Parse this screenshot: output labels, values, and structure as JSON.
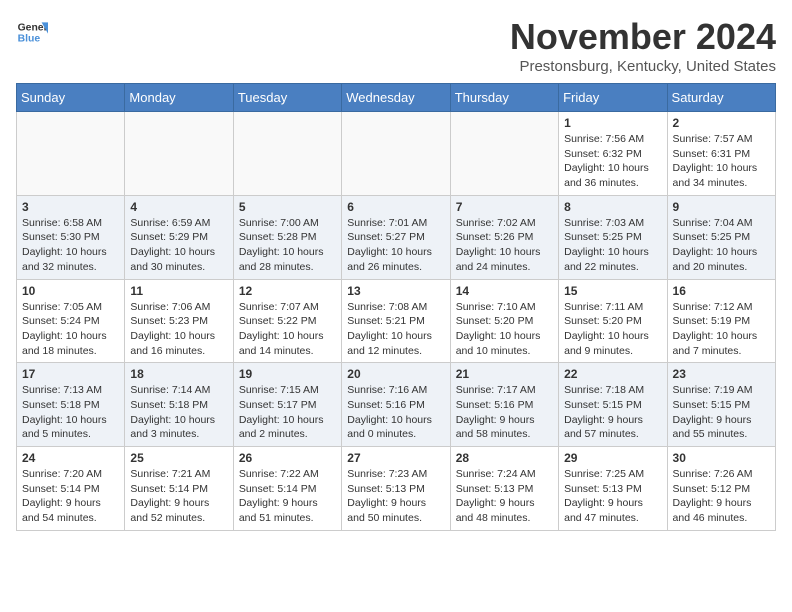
{
  "header": {
    "logo_line1": "General",
    "logo_line2": "Blue",
    "month_year": "November 2024",
    "location": "Prestonsburg, Kentucky, United States"
  },
  "days_of_week": [
    "Sunday",
    "Monday",
    "Tuesday",
    "Wednesday",
    "Thursday",
    "Friday",
    "Saturday"
  ],
  "weeks": [
    [
      {
        "day": "",
        "info": ""
      },
      {
        "day": "",
        "info": ""
      },
      {
        "day": "",
        "info": ""
      },
      {
        "day": "",
        "info": ""
      },
      {
        "day": "",
        "info": ""
      },
      {
        "day": "1",
        "info": "Sunrise: 7:56 AM\nSunset: 6:32 PM\nDaylight: 10 hours and 36 minutes."
      },
      {
        "day": "2",
        "info": "Sunrise: 7:57 AM\nSunset: 6:31 PM\nDaylight: 10 hours and 34 minutes."
      }
    ],
    [
      {
        "day": "3",
        "info": "Sunrise: 6:58 AM\nSunset: 5:30 PM\nDaylight: 10 hours and 32 minutes."
      },
      {
        "day": "4",
        "info": "Sunrise: 6:59 AM\nSunset: 5:29 PM\nDaylight: 10 hours and 30 minutes."
      },
      {
        "day": "5",
        "info": "Sunrise: 7:00 AM\nSunset: 5:28 PM\nDaylight: 10 hours and 28 minutes."
      },
      {
        "day": "6",
        "info": "Sunrise: 7:01 AM\nSunset: 5:27 PM\nDaylight: 10 hours and 26 minutes."
      },
      {
        "day": "7",
        "info": "Sunrise: 7:02 AM\nSunset: 5:26 PM\nDaylight: 10 hours and 24 minutes."
      },
      {
        "day": "8",
        "info": "Sunrise: 7:03 AM\nSunset: 5:25 PM\nDaylight: 10 hours and 22 minutes."
      },
      {
        "day": "9",
        "info": "Sunrise: 7:04 AM\nSunset: 5:25 PM\nDaylight: 10 hours and 20 minutes."
      }
    ],
    [
      {
        "day": "10",
        "info": "Sunrise: 7:05 AM\nSunset: 5:24 PM\nDaylight: 10 hours and 18 minutes."
      },
      {
        "day": "11",
        "info": "Sunrise: 7:06 AM\nSunset: 5:23 PM\nDaylight: 10 hours and 16 minutes."
      },
      {
        "day": "12",
        "info": "Sunrise: 7:07 AM\nSunset: 5:22 PM\nDaylight: 10 hours and 14 minutes."
      },
      {
        "day": "13",
        "info": "Sunrise: 7:08 AM\nSunset: 5:21 PM\nDaylight: 10 hours and 12 minutes."
      },
      {
        "day": "14",
        "info": "Sunrise: 7:10 AM\nSunset: 5:20 PM\nDaylight: 10 hours and 10 minutes."
      },
      {
        "day": "15",
        "info": "Sunrise: 7:11 AM\nSunset: 5:20 PM\nDaylight: 10 hours and 9 minutes."
      },
      {
        "day": "16",
        "info": "Sunrise: 7:12 AM\nSunset: 5:19 PM\nDaylight: 10 hours and 7 minutes."
      }
    ],
    [
      {
        "day": "17",
        "info": "Sunrise: 7:13 AM\nSunset: 5:18 PM\nDaylight: 10 hours and 5 minutes."
      },
      {
        "day": "18",
        "info": "Sunrise: 7:14 AM\nSunset: 5:18 PM\nDaylight: 10 hours and 3 minutes."
      },
      {
        "day": "19",
        "info": "Sunrise: 7:15 AM\nSunset: 5:17 PM\nDaylight: 10 hours and 2 minutes."
      },
      {
        "day": "20",
        "info": "Sunrise: 7:16 AM\nSunset: 5:16 PM\nDaylight: 10 hours and 0 minutes."
      },
      {
        "day": "21",
        "info": "Sunrise: 7:17 AM\nSunset: 5:16 PM\nDaylight: 9 hours and 58 minutes."
      },
      {
        "day": "22",
        "info": "Sunrise: 7:18 AM\nSunset: 5:15 PM\nDaylight: 9 hours and 57 minutes."
      },
      {
        "day": "23",
        "info": "Sunrise: 7:19 AM\nSunset: 5:15 PM\nDaylight: 9 hours and 55 minutes."
      }
    ],
    [
      {
        "day": "24",
        "info": "Sunrise: 7:20 AM\nSunset: 5:14 PM\nDaylight: 9 hours and 54 minutes."
      },
      {
        "day": "25",
        "info": "Sunrise: 7:21 AM\nSunset: 5:14 PM\nDaylight: 9 hours and 52 minutes."
      },
      {
        "day": "26",
        "info": "Sunrise: 7:22 AM\nSunset: 5:14 PM\nDaylight: 9 hours and 51 minutes."
      },
      {
        "day": "27",
        "info": "Sunrise: 7:23 AM\nSunset: 5:13 PM\nDaylight: 9 hours and 50 minutes."
      },
      {
        "day": "28",
        "info": "Sunrise: 7:24 AM\nSunset: 5:13 PM\nDaylight: 9 hours and 48 minutes."
      },
      {
        "day": "29",
        "info": "Sunrise: 7:25 AM\nSunset: 5:13 PM\nDaylight: 9 hours and 47 minutes."
      },
      {
        "day": "30",
        "info": "Sunrise: 7:26 AM\nSunset: 5:12 PM\nDaylight: 9 hours and 46 minutes."
      }
    ]
  ]
}
